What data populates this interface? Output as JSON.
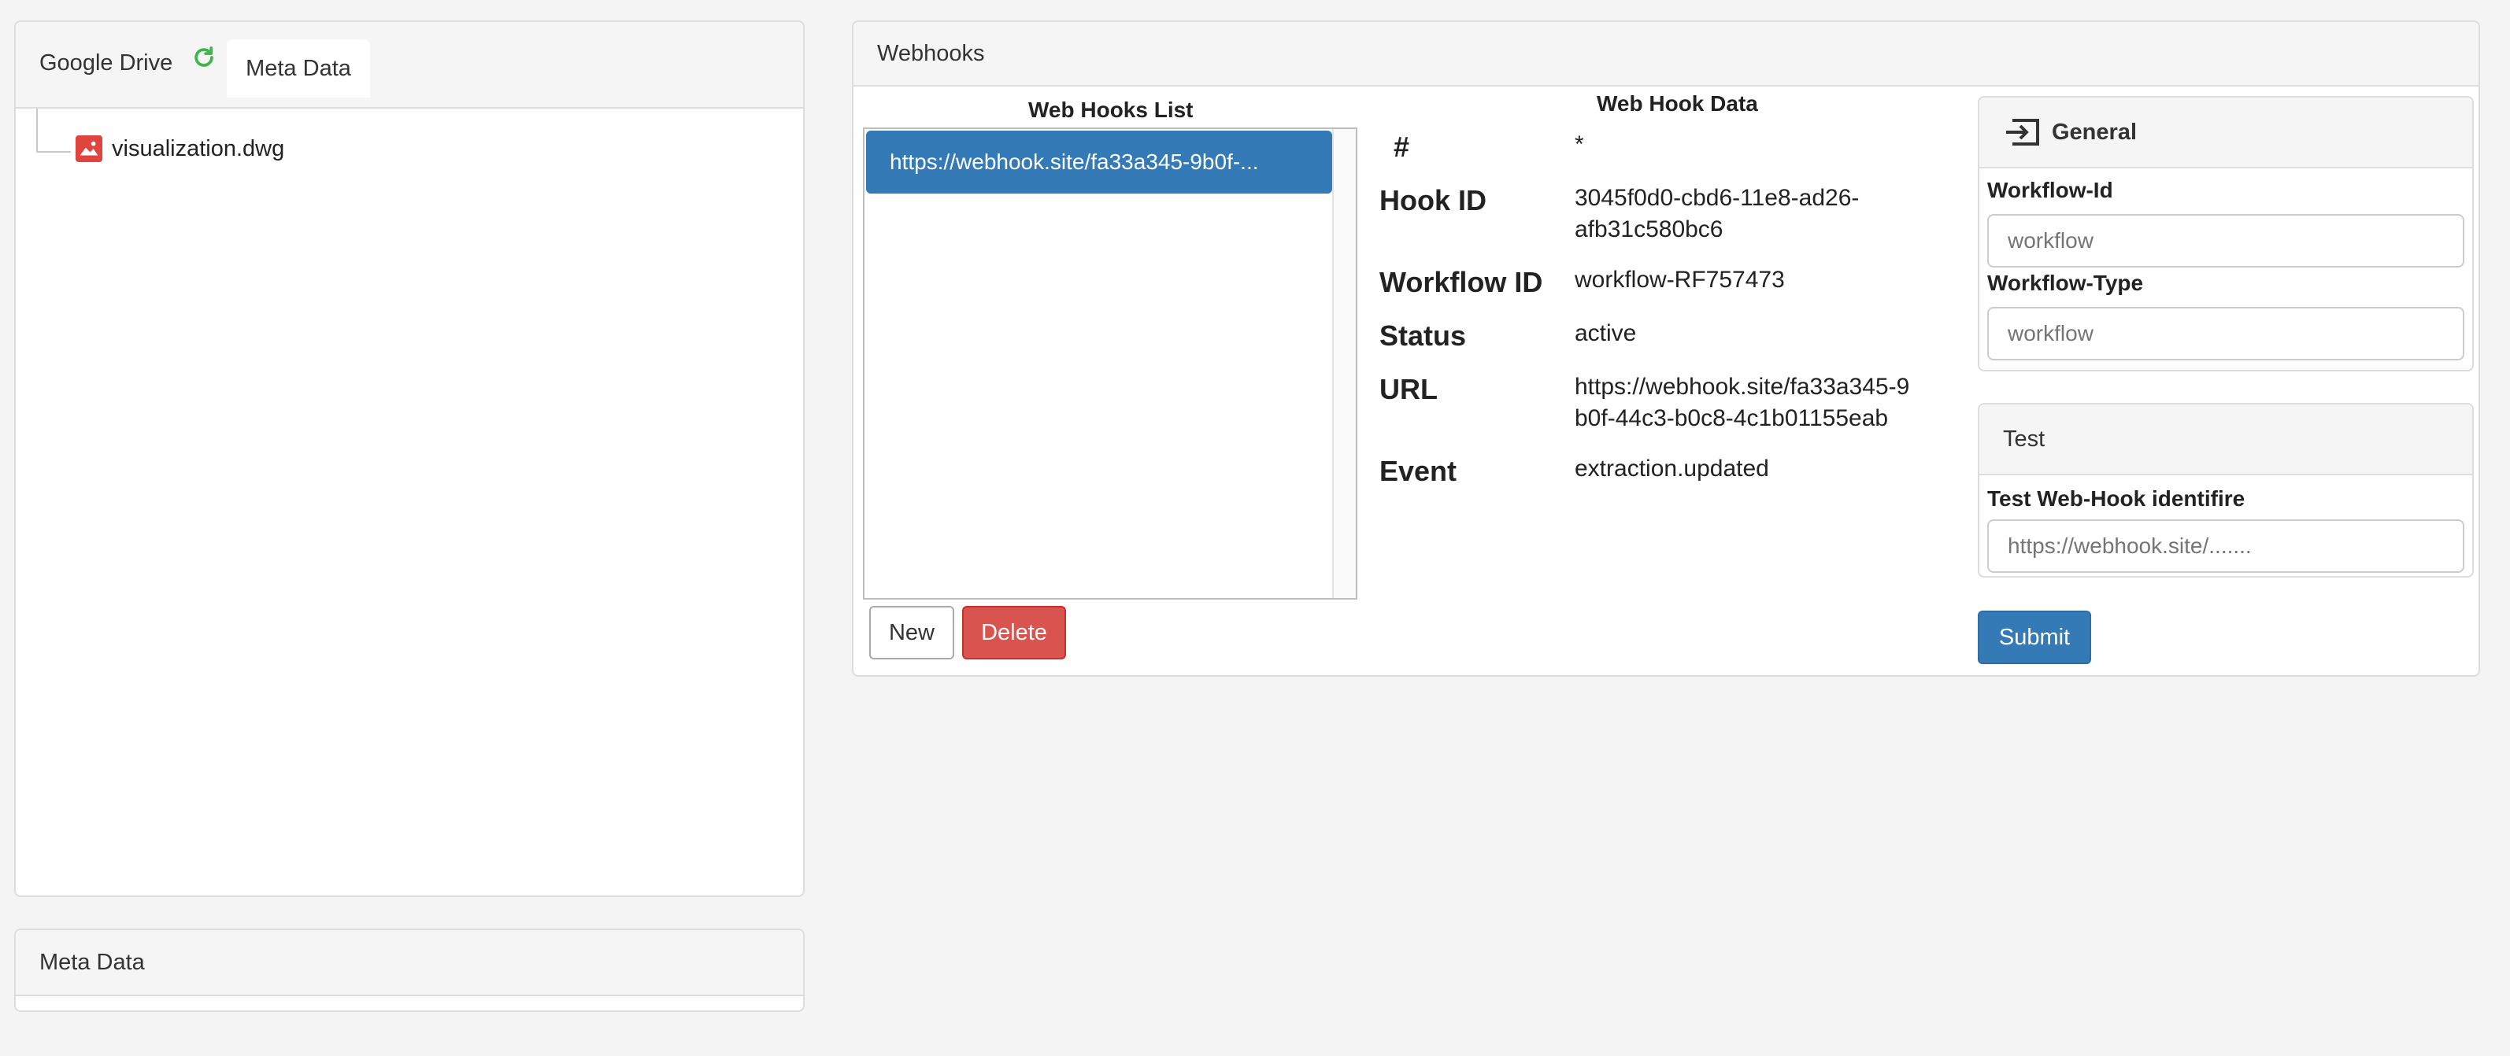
{
  "left_panel": {
    "tab_drive_label": "Google Drive",
    "tab_meta_label": "Meta Data",
    "tree": [
      {
        "name": "visualization.dwg",
        "icon": "image-file-icon"
      }
    ]
  },
  "meta_panel": {
    "title": "Meta Data"
  },
  "webhooks": {
    "title": "Webhooks",
    "list_title": "Web Hooks List",
    "items": [
      "https://webhook.site/fa33a345-9b0f-..."
    ],
    "new_label": "New",
    "delete_label": "Delete",
    "data_title": "Web Hook Data",
    "fields": {
      "hash_label": "#",
      "hash_value": "*",
      "hook_id_label": "Hook ID",
      "hook_id_value": "3045f0d0-cbd6-11e8-ad26-afb31c580bc6",
      "workflow_id_label": "Workflow ID",
      "workflow_id_value": "workflow-RF757473",
      "status_label": "Status",
      "status_value": "active",
      "url_label": "URL",
      "url_value": "https://webhook.site/fa33a345-9b0f-44c3-b0c8-4c1b01155eab",
      "event_label": "Event",
      "event_value": "extraction.updated"
    }
  },
  "general": {
    "title": "General",
    "workflow_id_label": "Workflow-Id",
    "workflow_id_placeholder": "workflow",
    "workflow_type_label": "Workflow-Type",
    "workflow_type_placeholder": "workflow"
  },
  "test": {
    "title": "Test",
    "identifier_label": "Test Web-Hook identifire",
    "identifier_placeholder": "https://webhook.site/.......",
    "submit_label": "Submit"
  },
  "colors": {
    "primary": "#337ab7",
    "danger": "#d9534f",
    "refresh_green": "#3cb54a"
  }
}
